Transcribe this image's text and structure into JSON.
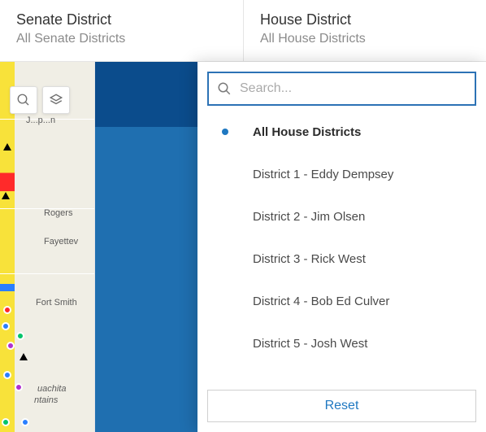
{
  "colors": {
    "accent": "#1f78c1",
    "panel_blue": "#1f6fb0",
    "panel_dark": "#0b4c8c"
  },
  "filters": {
    "senate": {
      "title": "Senate District",
      "value": "All Senate Districts"
    },
    "house": {
      "title": "House District",
      "value": "All House Districts"
    }
  },
  "search": {
    "placeholder": "Search..."
  },
  "dropdown": {
    "selected_index": 0,
    "options": [
      "All House Districts",
      "District 1 - Eddy Dempsey",
      "District 2 - Jim Olsen",
      "District 3 - Rick West",
      "District 4 - Bob Ed Culver",
      "District 5 - Josh West"
    ],
    "reset_label": "Reset"
  },
  "map": {
    "controls": {
      "search": "search-icon",
      "layers": "layers-icon"
    },
    "visible_labels": [
      "Rogers",
      "Fayettev",
      "Fort Smith",
      "uachita",
      "ntains"
    ],
    "partial_text_visible": "a"
  }
}
